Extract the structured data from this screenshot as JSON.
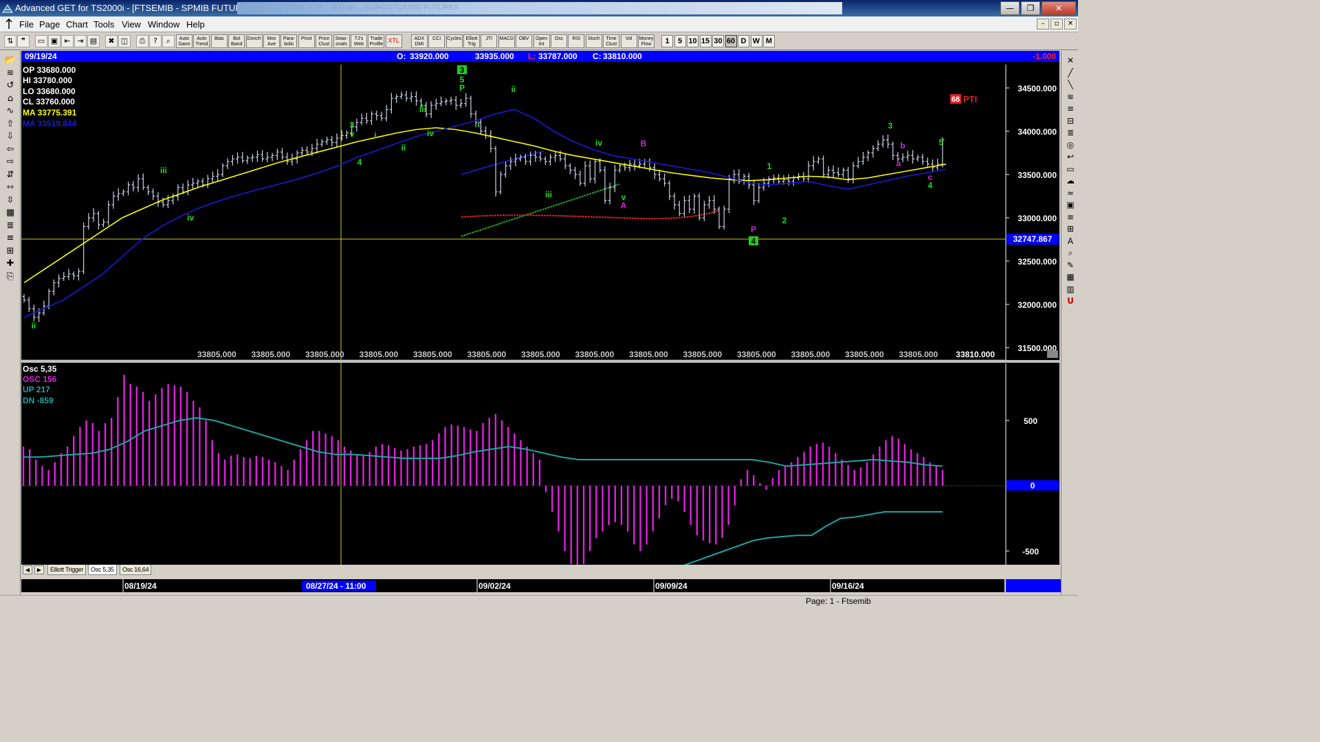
{
  "window": {
    "title": "Advanced GET for TS2000i - [FTSEMIB - SPMIB FUTURES, 60]",
    "blurred_caption": "...analysis - ... Elliott GTF ... 60 min ... EUROSTOXX50 FUTURES",
    "minimize": "—",
    "maximize": "❐",
    "close": "✕"
  },
  "menu": {
    "items": [
      {
        "label": "File",
        "mnemonic": "F"
      },
      {
        "label": "Page",
        "mnemonic": "P"
      },
      {
        "label": "Chart",
        "mnemonic": "C"
      },
      {
        "label": "Tools",
        "mnemonic": "T"
      },
      {
        "label": "View",
        "mnemonic": "V"
      },
      {
        "label": "Window",
        "mnemonic": "W"
      },
      {
        "label": "Help",
        "mnemonic": "H"
      }
    ],
    "mdi_minimize": "–",
    "mdi_restore": "▫",
    "mdi_close": "✕"
  },
  "toolbar": {
    "study_buttons": [
      "Auto Gann",
      "Auto Trend",
      "Bias",
      "Bol Band",
      "Donch",
      "Mov Ave",
      "Para- bolic",
      "Pivot",
      "Price Clust",
      "Seas- onals",
      "TJ's Web",
      "Trade Profile",
      "XTL",
      "ADX DMI",
      "CCI",
      "Cycles",
      "Elliott Trig",
      "JTI",
      "MACD",
      "OBV",
      "Open Int",
      "Osc",
      "RSI",
      "Stoch",
      "Time Clust",
      "Vol",
      "Money Flow"
    ],
    "interval_buttons": [
      "1",
      "5",
      "10",
      "15",
      "30",
      "60",
      "D",
      "W",
      "M"
    ],
    "active_interval": "60"
  },
  "chart_header": {
    "date": "09/19/24",
    "open_label": "O:",
    "open": "33920.000",
    "high": "33935.000",
    "low_label": "L:",
    "low": "33787.000",
    "close_label": "C:",
    "close": "33810.000",
    "change": "-1.000"
  },
  "legend": {
    "op": "OP  33680.000",
    "hi": "HI   33780.000",
    "lo": "LO  33680.000",
    "cl": "CL  33760.000",
    "ma1": "MA  33775.391",
    "ma2": "MA  33519.844"
  },
  "price_axis": {
    "ticks": [
      34500,
      34000,
      33500,
      33000,
      32500,
      32000,
      31500
    ],
    "tick_labels": [
      "34500.000",
      "34000.000",
      "33500.000",
      "33000.000",
      "32500.000",
      "32000.000",
      "31500.000"
    ],
    "cursor_price": "32747.867",
    "last_label": "33810.000",
    "bottom_repeat": "33805.000"
  },
  "time_axis": {
    "labels": [
      "08/19/24",
      "09/02/24",
      "09/09/24",
      "09/16/24"
    ],
    "cursor_label": "08/27/24 - 11:00"
  },
  "pti": {
    "value": "68",
    "label": "PTI"
  },
  "osc_legend": {
    "title": "Osc 5,35",
    "osc": "OSC 156",
    "up": "UP   217",
    "dn": "DN   -859"
  },
  "osc_axis": {
    "ticks": [
      500,
      0,
      -500
    ],
    "tick_labels": [
      "500",
      "0",
      "-500"
    ]
  },
  "tabs": {
    "items": [
      "Elliott Trigger",
      "Osc 5,35",
      "Osc 16,64"
    ],
    "active": "Osc 5,35"
  },
  "status": {
    "text": "Page: 1 - Ftsemib"
  },
  "colors": {
    "background": "#000000",
    "header_bar": "#0000ff",
    "ma_fast": "#ffff00",
    "ma_slow": "#1a1adc",
    "osc": "#e020e0",
    "band": "#1aa8a8",
    "wave_green": "#22dd22",
    "wave_magenta": "#dd22dd",
    "bars": "#cfd6e8"
  },
  "chart_data": [
    {
      "type": "ohlc",
      "name_on_chart": "FTSEMIB - SPMIB FUTURES, 60",
      "x_labels": [
        "08/19/24",
        "09/02/24",
        "09/09/24",
        "09/16/24"
      ],
      "ylim": [
        31500,
        34700
      ],
      "closes": [
        32050,
        31950,
        31850,
        31900,
        31980,
        32150,
        32250,
        32300,
        32320,
        32350,
        32330,
        32380,
        32900,
        33000,
        33050,
        32920,
        32950,
        33150,
        33250,
        33280,
        33300,
        33380,
        33350,
        33450,
        33350,
        33300,
        33250,
        33180,
        33150,
        33200,
        33250,
        33350,
        33300,
        33380,
        33400,
        33420,
        33380,
        33450,
        33480,
        33500,
        33600,
        33650,
        33680,
        33700,
        33660,
        33690,
        33700,
        33730,
        33680,
        33700,
        33720,
        33760,
        33700,
        33650,
        33680,
        33750,
        33780,
        33760,
        33800,
        33850,
        33880,
        33900,
        33870,
        33920,
        33950,
        33980,
        34050,
        34100,
        34150,
        34120,
        34200,
        34180,
        34150,
        34250,
        34380,
        34400,
        34420,
        34380,
        34400,
        34350,
        34300,
        34200,
        34300,
        34320,
        34340,
        34350,
        34360,
        34300,
        34320,
        34380,
        34200,
        34100,
        34000,
        33950,
        33800,
        33300,
        33500,
        33600,
        33650,
        33680,
        33700,
        33650,
        33720,
        33700,
        33680,
        33650,
        33700,
        33720,
        33680,
        33600,
        33550,
        33500,
        33400,
        33600,
        33450,
        33650,
        33550,
        33200,
        33350,
        33550,
        33600,
        33580,
        33620,
        33600,
        33620,
        33650,
        33580,
        33500,
        33450,
        33400,
        33250,
        33150,
        33050,
        33200,
        33100,
        33250,
        33000,
        33150,
        33200,
        33100,
        32900,
        33100,
        33450,
        33500,
        33420,
        33480,
        33380,
        33200,
        33350,
        33400,
        33450,
        33460,
        33420,
        33440,
        33420,
        33460,
        33480,
        33450,
        33600,
        33650,
        33680,
        33500,
        33550,
        33520,
        33500,
        33550,
        33450,
        33600,
        33650,
        33700,
        33750,
        33800,
        33850,
        33900,
        33850,
        33720,
        33680,
        33700,
        33720,
        33680,
        33700,
        33650,
        33620,
        33580,
        33620,
        33900
      ]
    },
    {
      "type": "line",
      "name_on_chart": "MA",
      "values": [
        32250,
        32400,
        32550,
        32700,
        32850,
        33000,
        33100,
        33200,
        33280,
        33360,
        33430,
        33500,
        33570,
        33640,
        33700,
        33760,
        33820,
        33880,
        33930,
        33980,
        34020,
        34040,
        34020,
        33980,
        33930,
        33880,
        33830,
        33770,
        33720,
        33680,
        33640,
        33600,
        33560,
        33520,
        33490,
        33460,
        33440,
        33430,
        33440,
        33460,
        33480,
        33470,
        33440,
        33460,
        33500,
        33540,
        33580,
        33620
      ]
    },
    {
      "type": "line",
      "name_on_chart": "MA",
      "values": [
        31850,
        31950,
        32050,
        32200,
        32350,
        32550,
        32750,
        32900,
        33020,
        33120,
        33200,
        33270,
        33330,
        33390,
        33450,
        33520,
        33600,
        33700,
        33780,
        33860,
        33940,
        34000,
        34060,
        34120,
        34200,
        34250,
        34150,
        34000,
        33880,
        33790,
        33720,
        33680,
        33640,
        33600,
        33560,
        33520,
        33460,
        33400,
        33380,
        33400,
        33420,
        33370,
        33330,
        33380,
        33430,
        33480,
        33520,
        33560
      ]
    },
    {
      "type": "bar",
      "name_on_chart": "Osc 5,35",
      "ylim": [
        -900,
        1000
      ],
      "values": [
        300,
        280,
        200,
        150,
        120,
        180,
        250,
        300,
        380,
        450,
        500,
        480,
        420,
        480,
        520,
        680,
        850,
        780,
        760,
        720,
        650,
        700,
        750,
        780,
        770,
        760,
        720,
        650,
        600,
        500,
        350,
        250,
        200,
        230,
        240,
        220,
        210,
        230,
        220,
        200,
        180,
        150,
        120,
        200,
        280,
        350,
        420,
        420,
        400,
        380,
        350,
        300,
        270,
        240,
        230,
        260,
        300,
        320,
        310,
        290,
        270,
        280,
        300,
        310,
        320,
        350,
        400,
        450,
        470,
        460,
        450,
        430,
        420,
        480,
        520,
        550,
        500,
        450,
        400,
        350,
        300,
        250,
        200,
        -50,
        -200,
        -350,
        -500,
        -600,
        -650,
        -600,
        -500,
        -400,
        -350,
        -300,
        -280,
        -300,
        -350,
        -450,
        -500,
        -450,
        -350,
        -250,
        -150,
        -100,
        -120,
        -200,
        -300,
        -380,
        -420,
        -440,
        -450,
        -400,
        -300,
        -150,
        50,
        120,
        80,
        20,
        -30,
        60,
        120,
        150,
        180,
        220,
        260,
        300,
        320,
        330,
        300,
        250,
        200,
        160,
        120,
        140,
        180,
        240,
        300,
        350,
        380,
        360,
        320,
        280,
        250,
        220,
        180,
        150,
        120
      ]
    },
    {
      "type": "line",
      "name_on_chart": "UP",
      "values": [
        220,
        220,
        230,
        240,
        250,
        280,
        340,
        420,
        460,
        500,
        520,
        500,
        460,
        420,
        380,
        340,
        300,
        260,
        240,
        240,
        230,
        220,
        210,
        210,
        210,
        230,
        260,
        280,
        300,
        280,
        250,
        220,
        200,
        200,
        200,
        200,
        200,
        200,
        200,
        200,
        200,
        200,
        200,
        180,
        150,
        160,
        170,
        180,
        190,
        200,
        190,
        180,
        160,
        150
      ]
    },
    {
      "type": "line",
      "name_on_chart": "DN",
      "values": [
        -900,
        -870,
        -830,
        -780,
        -740,
        -700,
        -660,
        -620,
        -580,
        -540,
        -500,
        -460,
        -420,
        -400,
        -390,
        -380,
        -380,
        -310,
        -250,
        -240,
        -220,
        -200,
        -200,
        -200,
        -200,
        -200
      ]
    }
  ]
}
